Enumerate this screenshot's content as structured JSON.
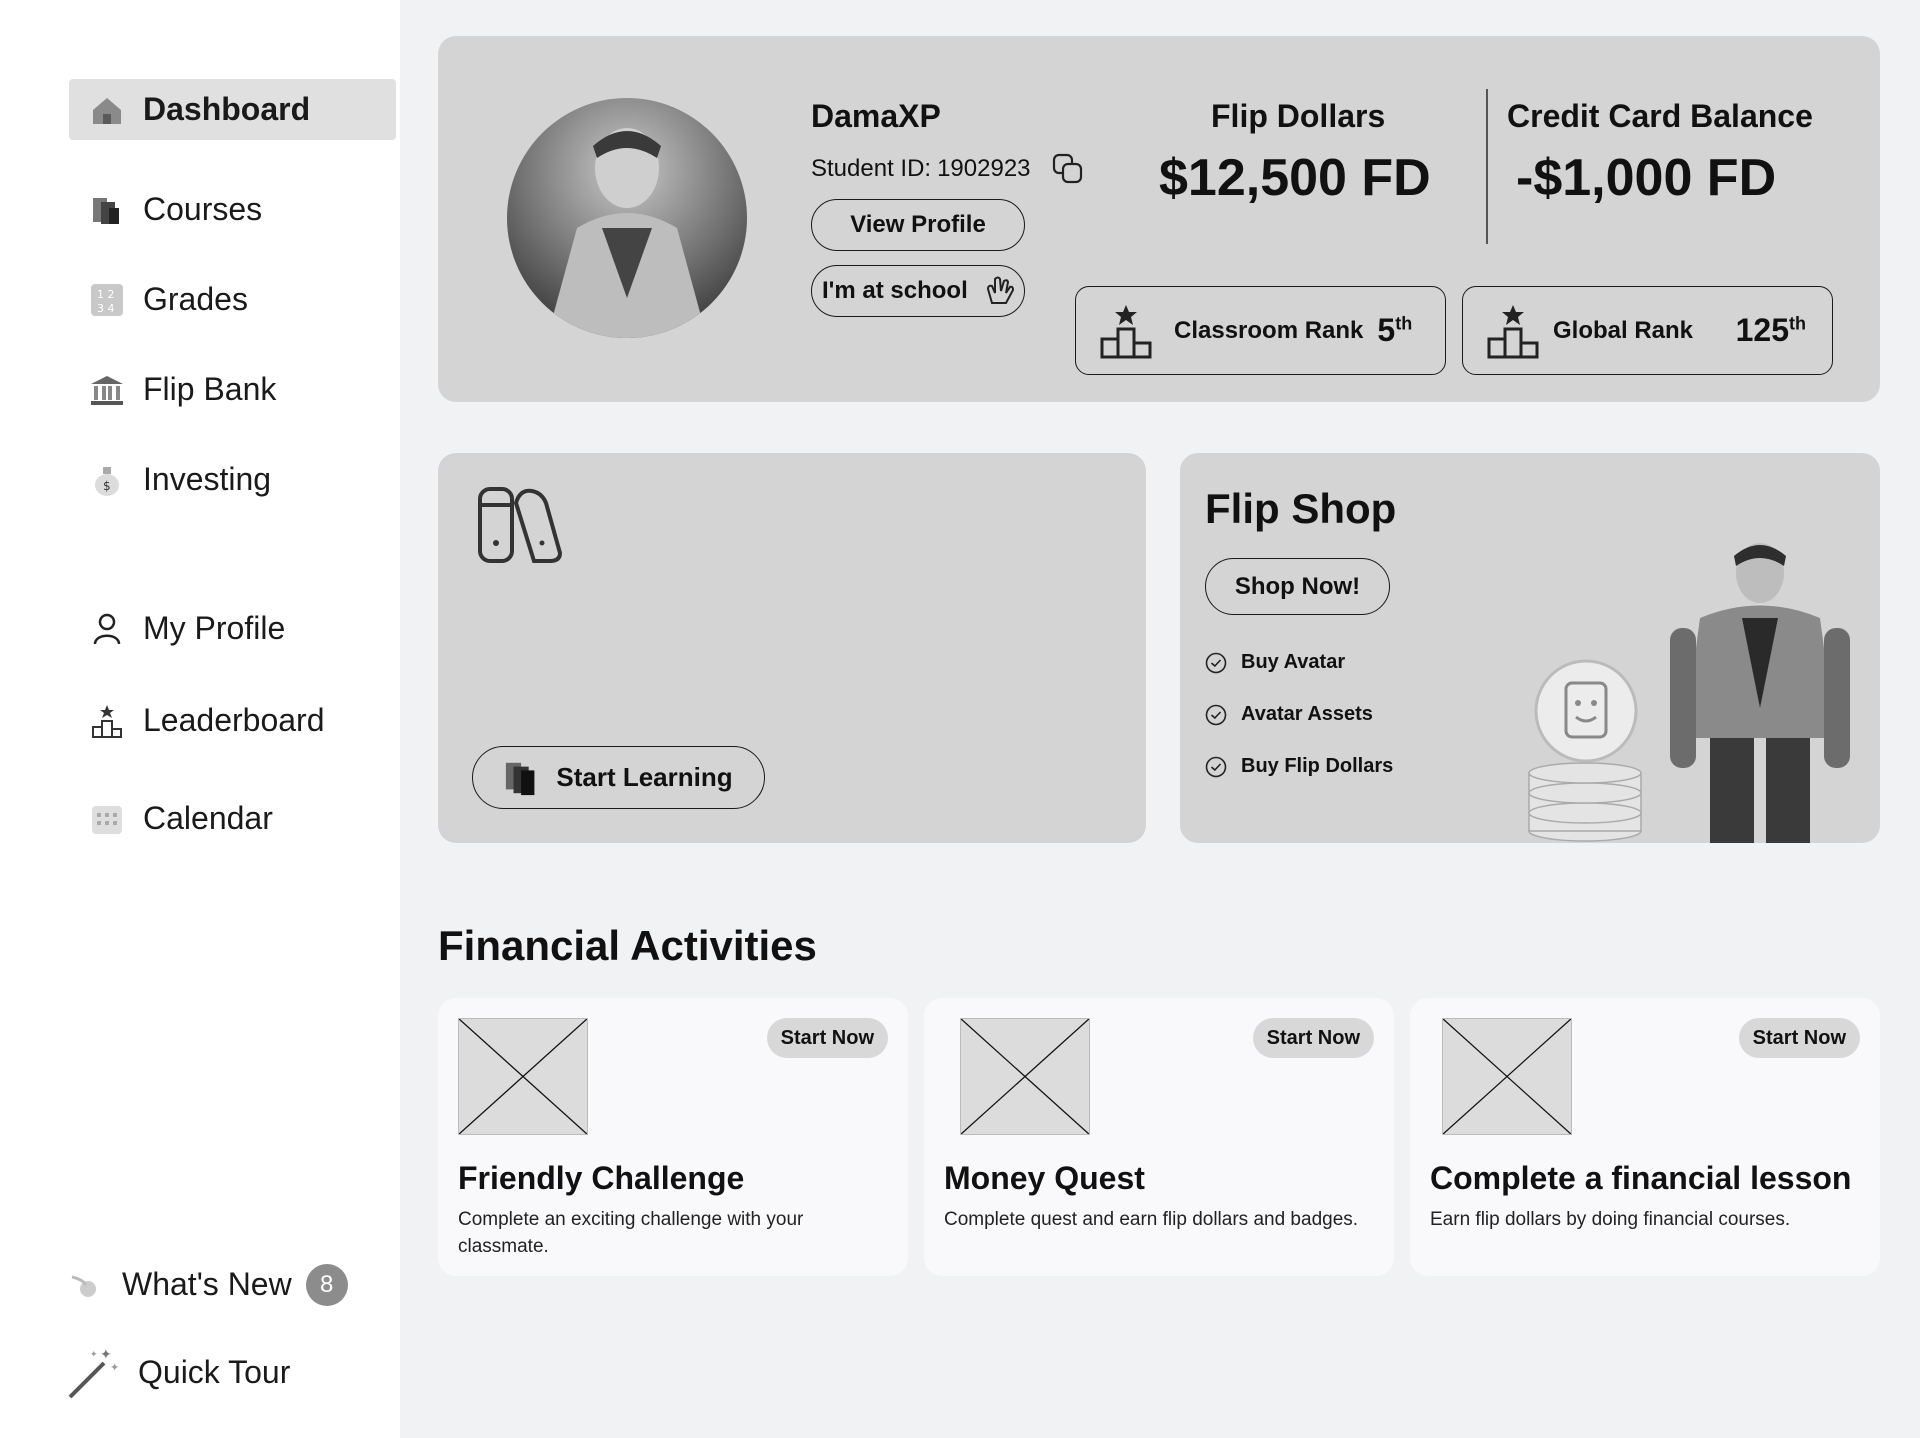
{
  "sidebar": {
    "items": [
      {
        "label": "Dashboard",
        "icon": "house-icon"
      },
      {
        "label": "Courses",
        "icon": "books-icon"
      },
      {
        "label": "Grades",
        "icon": "grades-grid-icon"
      },
      {
        "label": "Flip Bank",
        "icon": "bank-icon"
      },
      {
        "label": "Investing",
        "icon": "money-bag-icon"
      },
      {
        "label": "My Profile",
        "icon": "person-icon"
      },
      {
        "label": "Leaderboard",
        "icon": "podium-icon"
      },
      {
        "label": "Calendar",
        "icon": "calendar-icon"
      }
    ],
    "whats_new": {
      "label": "What's New",
      "count": "8"
    },
    "quick_tour": {
      "label": "Quick Tour"
    }
  },
  "profile": {
    "username": "DamaXP",
    "student_id_label": "Student ID:",
    "student_id": "1902923",
    "view_profile": "View Profile",
    "at_school": "I'm at school",
    "flip_dollars_label": "Flip Dollars",
    "flip_dollars_value": "$12,500 FD",
    "credit_label": "Credit Card Balance",
    "credit_value": "-$1,000 FD",
    "classroom_rank_label": "Classroom Rank",
    "classroom_rank_num": "5",
    "classroom_rank_suffix": "th",
    "global_rank_label": "Global Rank",
    "global_rank_num": "125",
    "global_rank_suffix": "th"
  },
  "learn": {
    "start_learning": "Start Learning"
  },
  "shop": {
    "title": "Flip Shop",
    "shop_now": "Shop Now!",
    "items": [
      "Buy Avatar",
      "Avatar Assets",
      "Buy Flip Dollars"
    ]
  },
  "activities": {
    "title": "Financial Activities",
    "cards": [
      {
        "badge": "Start Now",
        "title": "Friendly Challenge",
        "desc": "Complete an exciting challenge with your classmate."
      },
      {
        "badge": "Start Now",
        "title": "Money Quest",
        "desc": "Complete quest and earn flip dollars and badges."
      },
      {
        "badge": "Start Now",
        "title": "Complete a financial lesson",
        "desc": "Earn flip dollars by doing financial courses."
      }
    ]
  }
}
